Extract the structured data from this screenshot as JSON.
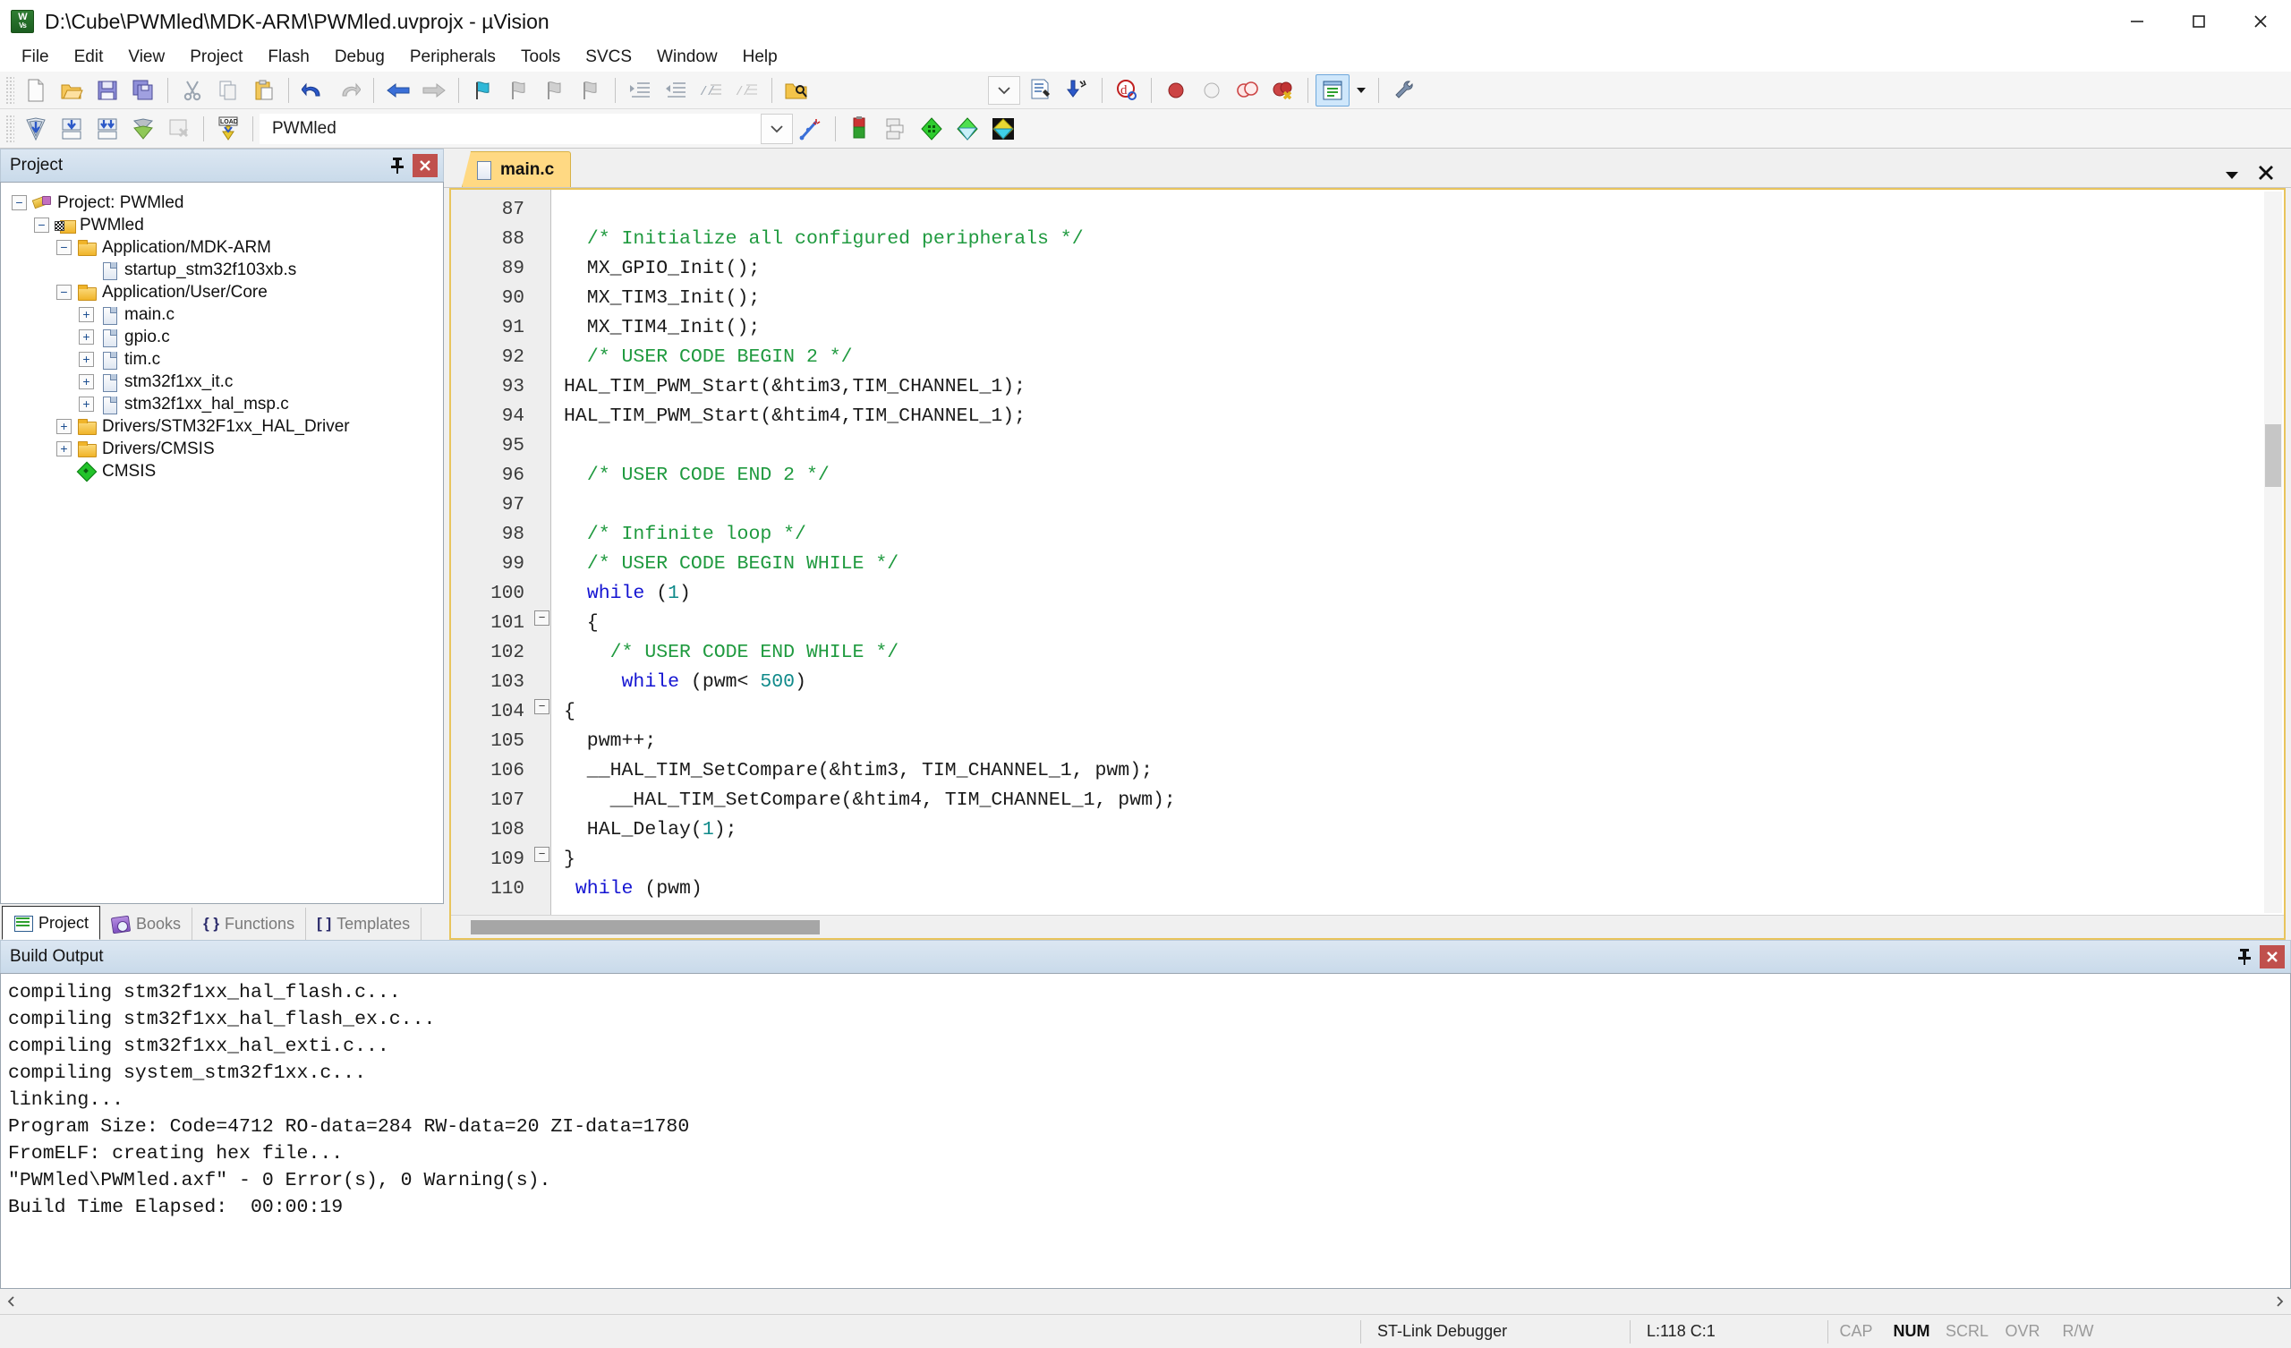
{
  "window": {
    "title": "D:\\Cube\\PWMled\\MDK-ARM\\PWMled.uvprojx - µVision",
    "app_icon": "uvision-icon",
    "minimize_label": "–",
    "maximize_label": "□",
    "close_label": "✕"
  },
  "menubar": {
    "items": [
      {
        "label": "File"
      },
      {
        "label": "Edit"
      },
      {
        "label": "View"
      },
      {
        "label": "Project"
      },
      {
        "label": "Flash"
      },
      {
        "label": "Debug"
      },
      {
        "label": "Peripherals"
      },
      {
        "label": "Tools"
      },
      {
        "label": "SVCS"
      },
      {
        "label": "Window"
      },
      {
        "label": "Help"
      }
    ]
  },
  "toolbar_main": {
    "buttons": [
      {
        "name": "new-file-icon",
        "tip": "New"
      },
      {
        "name": "open-file-icon",
        "tip": "Open"
      },
      {
        "name": "save-icon",
        "tip": "Save"
      },
      {
        "name": "save-all-icon",
        "tip": "Save All"
      },
      {
        "name": "cut-icon",
        "tip": "Cut"
      },
      {
        "name": "copy-icon",
        "tip": "Copy"
      },
      {
        "name": "paste-icon",
        "tip": "Paste"
      },
      {
        "name": "undo-icon",
        "tip": "Undo"
      },
      {
        "name": "redo-icon",
        "tip": "Redo"
      },
      {
        "name": "navigate-back-icon",
        "tip": "Back"
      },
      {
        "name": "navigate-forward-icon",
        "tip": "Forward"
      },
      {
        "name": "bookmark-toggle-icon",
        "tip": "Insert/Remove Bookmark"
      },
      {
        "name": "bookmark-prev-icon",
        "tip": "Previous Bookmark"
      },
      {
        "name": "bookmark-next-icon",
        "tip": "Next Bookmark"
      },
      {
        "name": "bookmark-clear-icon",
        "tip": "Clear All Bookmarks"
      },
      {
        "name": "indent-icon",
        "tip": "Indent"
      },
      {
        "name": "outdent-icon",
        "tip": "Outdent"
      },
      {
        "name": "comment-icon",
        "tip": "Comment Selection"
      },
      {
        "name": "uncomment-icon",
        "tip": "Uncomment Selection"
      },
      {
        "name": "find-in-files-icon",
        "tip": "Find in Files"
      },
      {
        "name": "combo-dropdown-icon",
        "tip": "Search combo"
      },
      {
        "name": "find-document-icon",
        "tip": "Find"
      },
      {
        "name": "incremental-find-icon",
        "tip": "Incremental Find"
      },
      {
        "name": "debug-session-icon",
        "tip": "Start/Stop Debug Session"
      },
      {
        "name": "breakpoint-insert-icon",
        "tip": "Insert/Remove Breakpoint"
      },
      {
        "name": "breakpoint-disable-icon",
        "tip": "Enable/Disable Breakpoint"
      },
      {
        "name": "breakpoint-disable-all-icon",
        "tip": "Disable All Breakpoints"
      },
      {
        "name": "breakpoint-kill-all-icon",
        "tip": "Kill All Breakpoints"
      },
      {
        "name": "project-window-icon",
        "tip": "Project Window",
        "active": true
      },
      {
        "name": "configure-icon",
        "tip": "Configuration Wizard"
      }
    ]
  },
  "toolbar_build": {
    "buttons": [
      {
        "name": "translate-file-icon",
        "tip": "Translate Current File"
      },
      {
        "name": "build-target-icon",
        "tip": "Build"
      },
      {
        "name": "rebuild-all-icon",
        "tip": "Rebuild All Target Files"
      },
      {
        "name": "batch-build-icon",
        "tip": "Batch Build"
      },
      {
        "name": "stop-build-icon",
        "tip": "Stop Build"
      },
      {
        "name": "download-icon",
        "tip": "Download",
        "glyph": "LOAD"
      },
      {
        "name": "target-options-icon",
        "tip": "Options for Target"
      },
      {
        "name": "manage-components-icon",
        "tip": "Manage Project Items"
      },
      {
        "name": "pack-installer-icon",
        "tip": "Pack Installer"
      },
      {
        "name": "run-time-env-icon",
        "tip": "Manage Run-Time Environment"
      },
      {
        "name": "select-software-packs-icon",
        "tip": "Select Software Packs"
      }
    ],
    "target_select": {
      "value": "PWMled",
      "dropdown_icon": "chevron-down-icon"
    },
    "wizard_icon": "project-wizard-icon"
  },
  "project_pane": {
    "title": "Project",
    "pin_icon": "pin-icon",
    "close_icon": "close-icon",
    "tree": [
      {
        "level": 0,
        "expander": "−",
        "icon": "project-icon",
        "label": "Project: PWMled"
      },
      {
        "level": 1,
        "expander": "−",
        "icon": "target-folder-icon",
        "label": "PWMled"
      },
      {
        "level": 2,
        "expander": "−",
        "icon": "folder-icon",
        "label": "Application/MDK-ARM"
      },
      {
        "level": 3,
        "expander": "",
        "icon": "file-icon",
        "label": "startup_stm32f103xb.s"
      },
      {
        "level": 2,
        "expander": "−",
        "icon": "folder-icon",
        "label": "Application/User/Core"
      },
      {
        "level": 3,
        "expander": "+",
        "icon": "file-icon",
        "label": "main.c"
      },
      {
        "level": 3,
        "expander": "+",
        "icon": "file-icon",
        "label": "gpio.c"
      },
      {
        "level": 3,
        "expander": "+",
        "icon": "file-icon",
        "label": "tim.c"
      },
      {
        "level": 3,
        "expander": "+",
        "icon": "file-icon",
        "label": "stm32f1xx_it.c"
      },
      {
        "level": 3,
        "expander": "+",
        "icon": "file-icon",
        "label": "stm32f1xx_hal_msp.c"
      },
      {
        "level": 2,
        "expander": "+",
        "icon": "folder-icon",
        "label": "Drivers/STM32F1xx_HAL_Driver"
      },
      {
        "level": 2,
        "expander": "+",
        "icon": "folder-icon",
        "label": "Drivers/CMSIS"
      },
      {
        "level": 2,
        "expander": "",
        "icon": "cmsis-diamond-icon",
        "label": "CMSIS"
      }
    ],
    "tabs": [
      {
        "label": "Project",
        "icon": "project-list-icon",
        "selected": true
      },
      {
        "label": "Books",
        "icon": "books-icon",
        "selected": false
      },
      {
        "label": "Functions",
        "icon": "braces-icon",
        "glyph": "{ }",
        "selected": false
      },
      {
        "label": "Templates",
        "icon": "templates-icon",
        "glyph": "[ ]",
        "selected": false
      }
    ]
  },
  "editor": {
    "tabs": [
      {
        "label": "main.c",
        "icon": "c-file-icon",
        "active": true
      }
    ],
    "tab_dropdown_icon": "chevron-down-icon",
    "tab_close_icon": "close-icon",
    "first_line_number": 87,
    "lines": [
      {
        "n": 87,
        "fold": "",
        "tokens": []
      },
      {
        "n": 88,
        "fold": "",
        "tokens": [
          {
            "t": "pln",
            "v": "  "
          },
          {
            "t": "cmt",
            "v": "/* Initialize all configured peripherals */"
          }
        ]
      },
      {
        "n": 89,
        "fold": "",
        "tokens": [
          {
            "t": "pln",
            "v": "  MX_GPIO_Init();"
          }
        ]
      },
      {
        "n": 90,
        "fold": "",
        "tokens": [
          {
            "t": "pln",
            "v": "  MX_TIM3_Init();"
          }
        ]
      },
      {
        "n": 91,
        "fold": "",
        "tokens": [
          {
            "t": "pln",
            "v": "  MX_TIM4_Init();"
          }
        ]
      },
      {
        "n": 92,
        "fold": "",
        "tokens": [
          {
            "t": "pln",
            "v": "  "
          },
          {
            "t": "cmt",
            "v": "/* USER CODE BEGIN 2 */"
          }
        ]
      },
      {
        "n": 93,
        "fold": "",
        "tokens": [
          {
            "t": "pln",
            "v": "HAL_TIM_PWM_Start(&htim3,TIM_CHANNEL_1);"
          }
        ]
      },
      {
        "n": 94,
        "fold": "",
        "tokens": [
          {
            "t": "pln",
            "v": "HAL_TIM_PWM_Start(&htim4,TIM_CHANNEL_1);"
          }
        ]
      },
      {
        "n": 95,
        "fold": "",
        "tokens": []
      },
      {
        "n": 96,
        "fold": "",
        "tokens": [
          {
            "t": "pln",
            "v": "  "
          },
          {
            "t": "cmt",
            "v": "/* USER CODE END 2 */"
          }
        ]
      },
      {
        "n": 97,
        "fold": "",
        "tokens": []
      },
      {
        "n": 98,
        "fold": "",
        "tokens": [
          {
            "t": "pln",
            "v": "  "
          },
          {
            "t": "cmt",
            "v": "/* Infinite loop */"
          }
        ]
      },
      {
        "n": 99,
        "fold": "",
        "tokens": [
          {
            "t": "pln",
            "v": "  "
          },
          {
            "t": "cmt",
            "v": "/* USER CODE BEGIN WHILE */"
          }
        ]
      },
      {
        "n": 100,
        "fold": "",
        "tokens": [
          {
            "t": "pln",
            "v": "  "
          },
          {
            "t": "kw",
            "v": "while"
          },
          {
            "t": "pln",
            "v": " ("
          },
          {
            "t": "num",
            "v": "1"
          },
          {
            "t": "pln",
            "v": ")"
          }
        ]
      },
      {
        "n": 101,
        "fold": "−",
        "tokens": [
          {
            "t": "pln",
            "v": "  {"
          }
        ]
      },
      {
        "n": 102,
        "fold": "",
        "tokens": [
          {
            "t": "pln",
            "v": "    "
          },
          {
            "t": "cmt",
            "v": "/* USER CODE END WHILE */"
          }
        ]
      },
      {
        "n": 103,
        "fold": "",
        "tokens": [
          {
            "t": "pln",
            "v": "     "
          },
          {
            "t": "kw",
            "v": "while"
          },
          {
            "t": "pln",
            "v": " (pwm< "
          },
          {
            "t": "num",
            "v": "500"
          },
          {
            "t": "pln",
            "v": ")"
          }
        ]
      },
      {
        "n": 104,
        "fold": "−",
        "tokens": [
          {
            "t": "pln",
            "v": "{"
          }
        ]
      },
      {
        "n": 105,
        "fold": "",
        "tokens": [
          {
            "t": "pln",
            "v": "  pwm++;"
          }
        ]
      },
      {
        "n": 106,
        "fold": "",
        "tokens": [
          {
            "t": "pln",
            "v": "  __HAL_TIM_SetCompare(&htim3, TIM_CHANNEL_1, pwm);"
          }
        ]
      },
      {
        "n": 107,
        "fold": "",
        "tokens": [
          {
            "t": "pln",
            "v": "    __HAL_TIM_SetCompare(&htim4, TIM_CHANNEL_1, pwm);"
          }
        ]
      },
      {
        "n": 108,
        "fold": "",
        "tokens": [
          {
            "t": "pln",
            "v": "  HAL_Delay("
          },
          {
            "t": "num",
            "v": "1"
          },
          {
            "t": "pln",
            "v": ");"
          }
        ]
      },
      {
        "n": 109,
        "fold": "−",
        "tokens": [
          {
            "t": "pln",
            "v": "}"
          }
        ]
      },
      {
        "n": 110,
        "fold": "",
        "tokens": [
          {
            "t": "pln",
            "v": " "
          },
          {
            "t": "kw",
            "v": "while"
          },
          {
            "t": "pln",
            "v": " (pwm)"
          }
        ]
      }
    ]
  },
  "build_output": {
    "title": "Build Output",
    "pin_icon": "pin-icon",
    "close_icon": "close-icon",
    "text": "compiling stm32f1xx_hal_flash.c...\ncompiling stm32f1xx_hal_flash_ex.c...\ncompiling stm32f1xx_hal_exti.c...\ncompiling system_stm32f1xx.c...\nlinking...\nProgram Size: Code=4712 RO-data=284 RW-data=20 ZI-data=1780  \nFromELF: creating hex file...\n\"PWMled\\PWMled.axf\" - 0 Error(s), 0 Warning(s).\nBuild Time Elapsed:  00:00:19",
    "scroll_left_icon": "chevron-left-icon",
    "scroll_right_icon": "chevron-right-icon"
  },
  "statusbar": {
    "debugger": "ST-Link Debugger",
    "cursor_position": "L:118 C:1",
    "indicators": [
      {
        "label": "CAP",
        "on": false
      },
      {
        "label": "NUM",
        "on": true
      },
      {
        "label": "SCRL",
        "on": false
      },
      {
        "label": "OVR",
        "on": false
      },
      {
        "label": "R/W",
        "on": false
      }
    ]
  },
  "colors": {
    "tab_active": "#ffd983",
    "editor_border": "#e8c45c",
    "comment": "#1f9a3f",
    "keyword": "#1414d2",
    "number": "#0f8a8a",
    "close_red": "#c0504d",
    "pane_header": "#cfdded"
  }
}
